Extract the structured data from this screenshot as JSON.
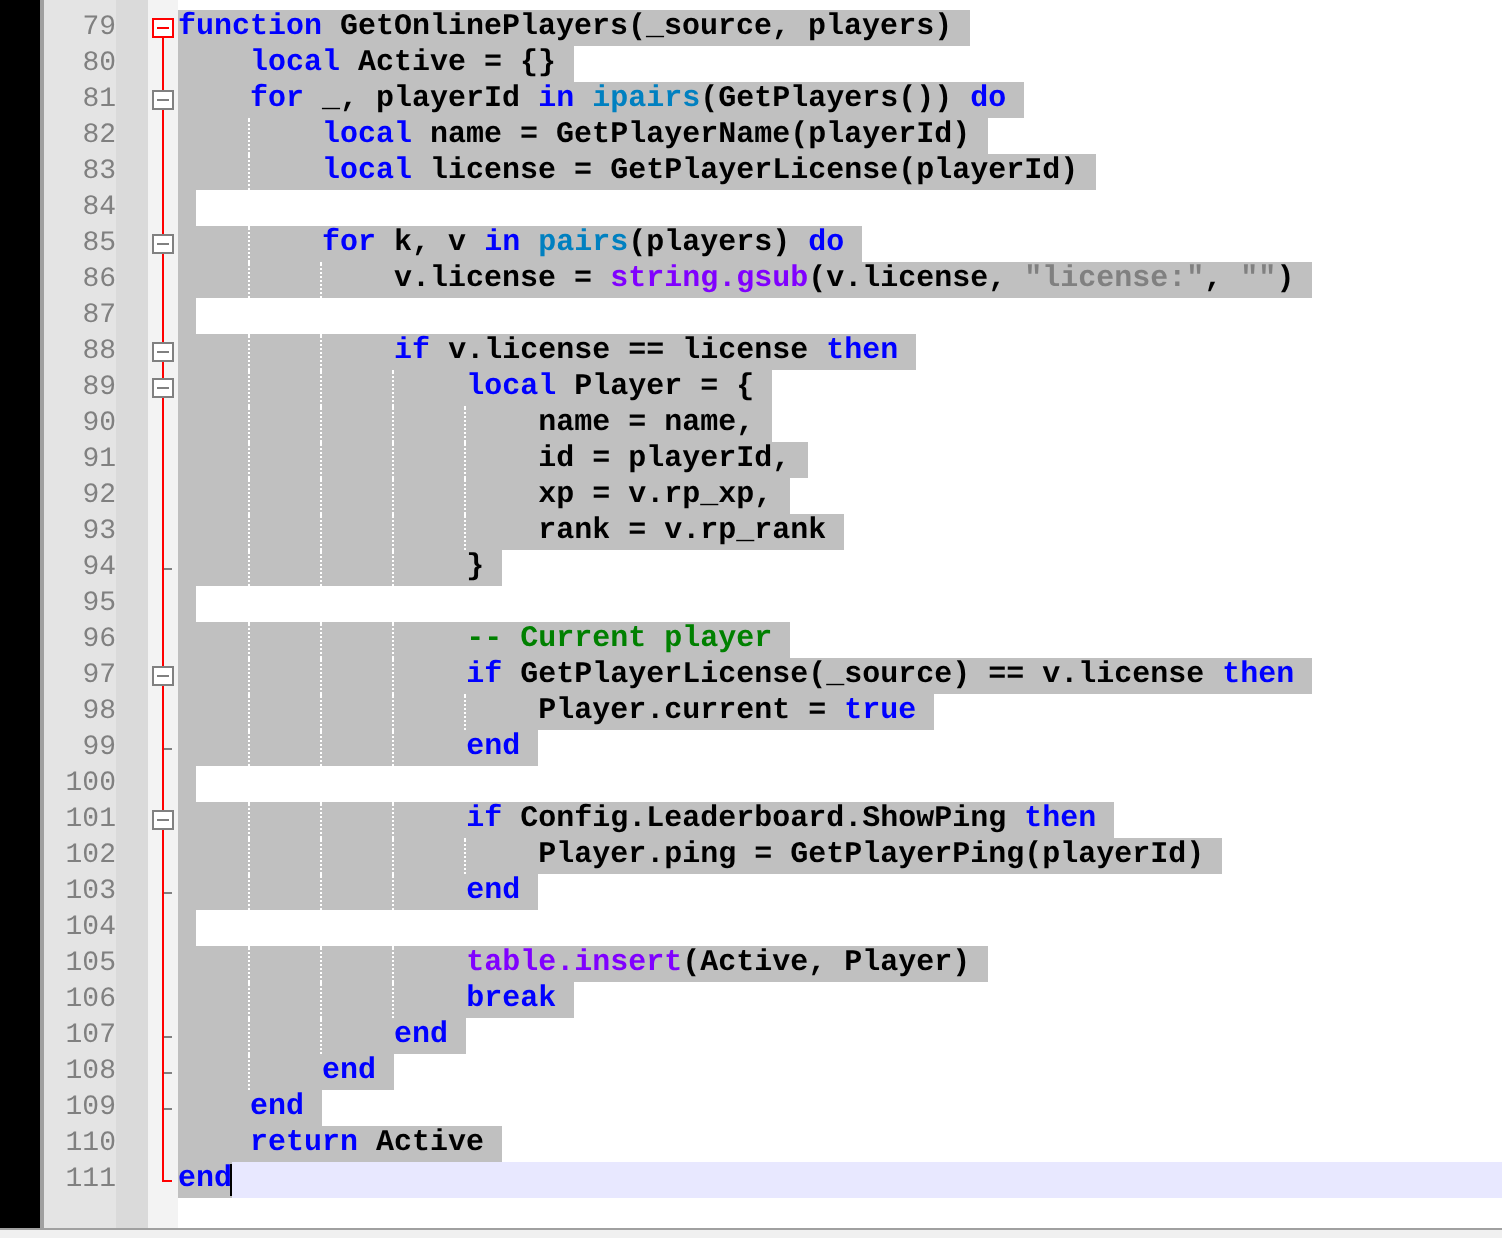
{
  "editor": {
    "lines": [
      {
        "number": "79",
        "selected": true,
        "current": false,
        "kind": "fold_start",
        "active": true,
        "tokens": [
          {
            "kind": "keyword",
            "text": "function"
          },
          {
            "kind": "plain",
            "text": " GetOnlinePlayers(_source, players)"
          }
        ]
      },
      {
        "number": "80",
        "selected": true,
        "current": false,
        "kind": "body",
        "tokens": [
          {
            "kind": "keyword",
            "text": "    local"
          },
          {
            "kind": "plain",
            "text": " Active = {}"
          }
        ]
      },
      {
        "number": "81",
        "selected": true,
        "current": false,
        "kind": "fold_start",
        "active": false,
        "tokens": [
          {
            "kind": "keyword",
            "text": "    for"
          },
          {
            "kind": "plain",
            "text": " _, playerId "
          },
          {
            "kind": "keyword",
            "text": "in "
          },
          {
            "kind": "builtin",
            "text": "ipairs"
          },
          {
            "kind": "plain",
            "text": "(GetPlayers()) "
          },
          {
            "kind": "keyword",
            "text": "do"
          }
        ]
      },
      {
        "number": "82",
        "selected": true,
        "current": false,
        "kind": "body",
        "tokens": [
          {
            "kind": "keyword",
            "text": "        local"
          },
          {
            "kind": "plain",
            "text": " name = GetPlayerName(playerId)"
          }
        ]
      },
      {
        "number": "83",
        "selected": true,
        "current": false,
        "kind": "body",
        "tokens": [
          {
            "kind": "keyword",
            "text": "        local"
          },
          {
            "kind": "plain",
            "text": " license = GetPlayerLicense(playerId)"
          }
        ]
      },
      {
        "number": "84",
        "selected": true,
        "current": false,
        "kind": "body"
      },
      {
        "number": "85",
        "selected": true,
        "current": false,
        "kind": "fold_start",
        "active": false,
        "tokens": [
          {
            "kind": "keyword",
            "text": "        for"
          },
          {
            "kind": "plain",
            "text": " k, v "
          },
          {
            "kind": "keyword",
            "text": "in "
          },
          {
            "kind": "builtin",
            "text": "pairs"
          },
          {
            "kind": "plain",
            "text": "(players) "
          },
          {
            "kind": "keyword",
            "text": "do"
          }
        ]
      },
      {
        "number": "86",
        "selected": true,
        "current": false,
        "kind": "body",
        "tokens": [
          {
            "kind": "plain",
            "text": "            v.license = "
          },
          {
            "kind": "library",
            "text": "string.gsub"
          },
          {
            "kind": "plain",
            "text": "(v.license, "
          },
          {
            "kind": "string",
            "text": "\"license:\""
          },
          {
            "kind": "plain",
            "text": ", "
          },
          {
            "kind": "string",
            "text": "\"\""
          },
          {
            "kind": "plain",
            "text": ")"
          }
        ]
      },
      {
        "number": "87",
        "selected": true,
        "current": false,
        "kind": "body"
      },
      {
        "number": "88",
        "selected": true,
        "current": false,
        "kind": "fold_start",
        "active": false,
        "tokens": [
          {
            "kind": "keyword",
            "text": "            if"
          },
          {
            "kind": "plain",
            "text": " v.license == license "
          },
          {
            "kind": "keyword",
            "text": "then"
          }
        ]
      },
      {
        "number": "89",
        "selected": true,
        "current": false,
        "kind": "fold_start",
        "active": false,
        "tokens": [
          {
            "kind": "keyword",
            "text": "                local"
          },
          {
            "kind": "plain",
            "text": " Player = {"
          }
        ]
      },
      {
        "number": "90",
        "selected": true,
        "current": false,
        "kind": "body",
        "tokens": [
          {
            "kind": "plain",
            "text": "                    name = name,"
          }
        ]
      },
      {
        "number": "91",
        "selected": true,
        "current": false,
        "kind": "body",
        "tokens": [
          {
            "kind": "plain",
            "text": "                    id = playerId,"
          }
        ]
      },
      {
        "number": "92",
        "selected": true,
        "current": false,
        "kind": "body",
        "tokens": [
          {
            "kind": "plain",
            "text": "                    xp = v.rp_xp,"
          }
        ]
      },
      {
        "number": "93",
        "selected": true,
        "current": false,
        "kind": "body",
        "tokens": [
          {
            "kind": "plain",
            "text": "                    rank = v.rp_rank"
          }
        ]
      },
      {
        "number": "94",
        "selected": true,
        "current": false,
        "kind": "fold_end",
        "active": false,
        "tokens": [
          {
            "kind": "plain",
            "text": "                }"
          }
        ]
      },
      {
        "number": "95",
        "selected": true,
        "current": false,
        "kind": "body"
      },
      {
        "number": "96",
        "selected": true,
        "current": false,
        "kind": "body",
        "tokens": [
          {
            "kind": "comment",
            "text": "                -- Current player"
          }
        ]
      },
      {
        "number": "97",
        "selected": true,
        "current": false,
        "kind": "fold_start",
        "active": false,
        "tokens": [
          {
            "kind": "keyword",
            "text": "                if"
          },
          {
            "kind": "plain",
            "text": " GetPlayerLicense(_source) == v.license "
          },
          {
            "kind": "keyword",
            "text": "then"
          }
        ]
      },
      {
        "number": "98",
        "selected": true,
        "current": false,
        "kind": "body",
        "tokens": [
          {
            "kind": "plain",
            "text": "                    Player.current = "
          },
          {
            "kind": "keyword",
            "text": "true"
          }
        ]
      },
      {
        "number": "99",
        "selected": true,
        "current": false,
        "kind": "fold_end",
        "active": false,
        "tokens": [
          {
            "kind": "keyword",
            "text": "                end"
          }
        ]
      },
      {
        "number": "100",
        "selected": true,
        "current": false,
        "kind": "body"
      },
      {
        "number": "101",
        "selected": true,
        "current": false,
        "kind": "fold_start",
        "active": false,
        "tokens": [
          {
            "kind": "keyword",
            "text": "                if"
          },
          {
            "kind": "plain",
            "text": " Config.Leaderboard.ShowPing "
          },
          {
            "kind": "keyword",
            "text": "then"
          }
        ]
      },
      {
        "number": "102",
        "selected": true,
        "current": false,
        "kind": "body",
        "tokens": [
          {
            "kind": "plain",
            "text": "                    Player.ping = GetPlayerPing(playerId)"
          }
        ]
      },
      {
        "number": "103",
        "selected": true,
        "current": false,
        "kind": "fold_end",
        "active": false,
        "tokens": [
          {
            "kind": "keyword",
            "text": "                end"
          }
        ]
      },
      {
        "number": "104",
        "selected": true,
        "current": false,
        "kind": "body"
      },
      {
        "number": "105",
        "selected": true,
        "current": false,
        "kind": "body",
        "tokens": [
          {
            "kind": "library",
            "text": "                table.insert"
          },
          {
            "kind": "plain",
            "text": "(Active, Player)"
          }
        ]
      },
      {
        "number": "106",
        "selected": true,
        "current": false,
        "kind": "body",
        "tokens": [
          {
            "kind": "keyword",
            "text": "                break"
          }
        ]
      },
      {
        "number": "107",
        "selected": true,
        "current": false,
        "kind": "fold_end",
        "active": false,
        "tokens": [
          {
            "kind": "keyword",
            "text": "            end"
          }
        ]
      },
      {
        "number": "108",
        "selected": true,
        "current": false,
        "kind": "fold_end",
        "active": false,
        "tokens": [
          {
            "kind": "keyword",
            "text": "        end"
          }
        ]
      },
      {
        "number": "109",
        "selected": true,
        "current": false,
        "kind": "fold_end",
        "active": false,
        "tokens": [
          {
            "kind": "keyword",
            "text": "    end"
          }
        ]
      },
      {
        "number": "110",
        "selected": true,
        "current": false,
        "kind": "body",
        "tokens": [
          {
            "kind": "keyword",
            "text": "    return"
          },
          {
            "kind": "plain",
            "text": " Active"
          }
        ]
      },
      {
        "number": "111",
        "selected": true,
        "current": true,
        "kind": "fold_end",
        "active": true,
        "tokens": [
          {
            "kind": "keyword",
            "text": "end"
          }
        ]
      }
    ]
  }
}
